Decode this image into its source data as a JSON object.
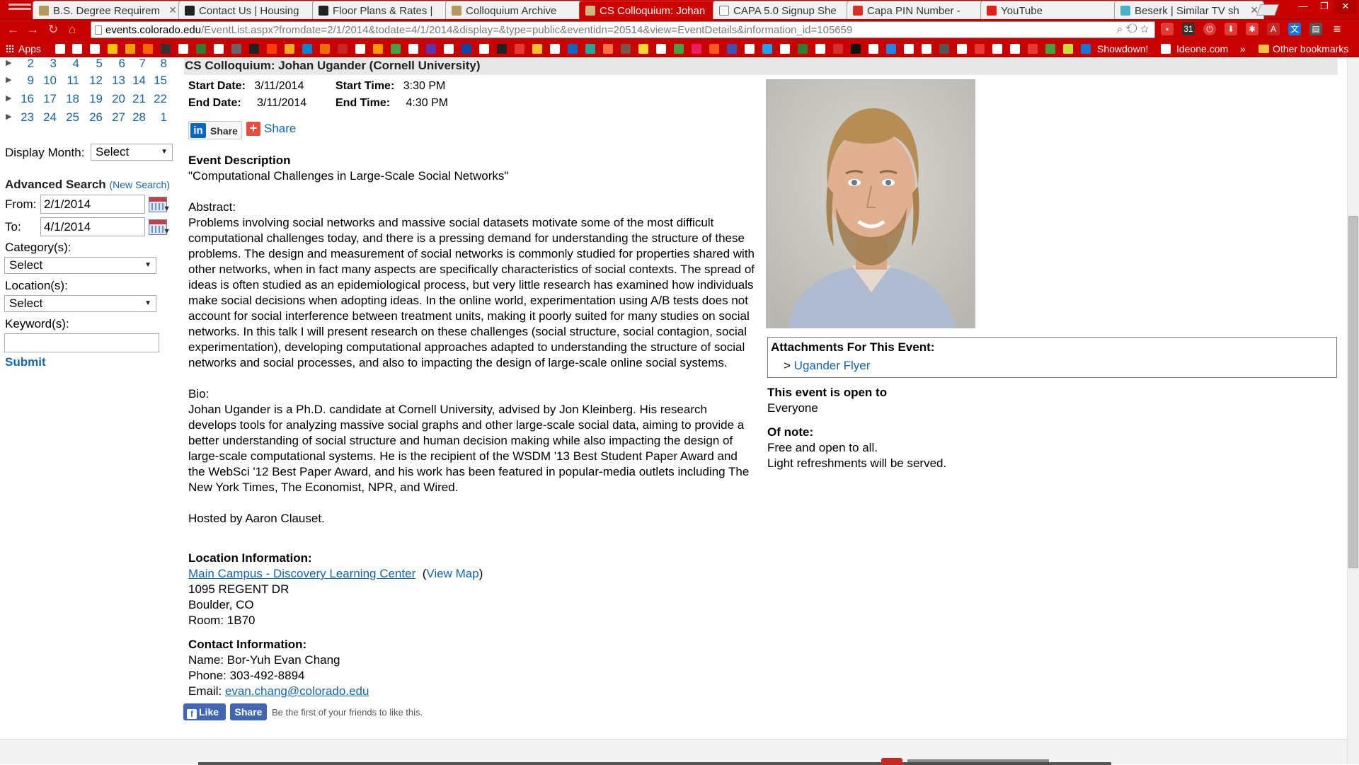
{
  "browser": {
    "tabs": [
      {
        "label": "B.S. Degree Requirem",
        "color": "#b5985a"
      },
      {
        "label": "Contact Us | Housing",
        "color": "#222222"
      },
      {
        "label": "Floor Plans & Rates |",
        "color": "#222222"
      },
      {
        "label": "Colloquium Archive",
        "color": "#b5985a"
      },
      {
        "label": "CS Colloquium: Johan",
        "color": "#cfb87c",
        "active": true
      },
      {
        "label": "CAPA 5.0 Signup She",
        "color": "#ffffff"
      },
      {
        "label": "Capa PIN Number -",
        "color": "#d93025"
      },
      {
        "label": "YouTube",
        "color": "#e62117"
      },
      {
        "label": "Beserk | Similar TV sh",
        "color": "#46b1c9"
      }
    ],
    "url_host": "events.colorado.edu",
    "url_path": "/EventList.aspx?fromdate=2/1/2014&todate=4/1/2014&display=&type=public&eventidn=20514&view=EventDetails&information_id=105659",
    "bookmarks": {
      "apps_label": "Apps",
      "showdown_label": "Showdown!",
      "ideone_label": "Ideone.com",
      "other_label": "Other bookmarks"
    }
  },
  "event": {
    "title": "CS Colloquium: Johan Ugander (Cornell University)",
    "start_date_label": "Start Date:",
    "start_date": "3/11/2014",
    "start_time_label": "Start Time:",
    "start_time": "3:30 PM",
    "end_date_label": "End Date:",
    "end_date": "3/11/2014",
    "end_time_label": "End Time:",
    "end_time": "4:30 PM",
    "linkedin_share": "Share",
    "addthis_share": "Share",
    "description_heading": "Event Description",
    "talk_title": "\"Computational Challenges in Large-Scale Social Networks\"",
    "abstract_heading": "Abstract:",
    "abstract": "Problems involving social networks and massive social datasets motivate some of the most difficult computational challenges today, and there is a pressing demand for understanding the structure of these problems. The design and measurement of social networks is commonly studied for properties shared with other networks, when in fact many aspects are specifically characteristics of social contexts. The spread of ideas is often studied as an epidemiological process, but very little research has examined how individuals make social decisions when adopting ideas. In the online world, experimentation using A/B tests does not account for social interference between treatment units, making it poorly suited for many studies on social networks. In this talk I will present research on these challenges (social structure, social contagion, social experimentation), developing computational approaches adapted to understanding the structure of social networks and social processes, and also to impacting the design of large-scale online social systems.",
    "bio_heading": "Bio:",
    "bio": "Johan Ugander is a Ph.D. candidate at Cornell University, advised by Jon Kleinberg. His research develops tools for analyzing massive social graphs and other large-scale social data, aiming to provide a better understanding of social structure and human decision making while also impacting the design of large-scale computational systems. He is the recipient of the WSDM '13 Best Student Paper Award and the WebSci '12 Best Paper Award, and his work has been featured in popular-media outlets including The New York Times, The Economist, NPR, and Wired.",
    "hosted_by": "Hosted by Aaron Clauset.",
    "location_heading": "Location Information:",
    "location_link": "Main Campus - Discovery Learning Center",
    "view_map_open": "(",
    "view_map": "View Map",
    "view_map_close": ")",
    "address1": "1095 REGENT DR",
    "address2": "Boulder, CO",
    "room": "Room: 1B70",
    "contact_heading": "Contact Information:",
    "contact_name": "Name: Bor-Yuh Evan Chang",
    "contact_phone": "Phone: 303-492-8894",
    "contact_email_label": "Email:",
    "contact_email": "evan.chang@colorado.edu",
    "fb_like": "Like",
    "fb_share": "Share",
    "fb_text": "Be the first of your friends to like this."
  },
  "sidebar": {
    "calendar_rows": [
      [
        "2",
        "3",
        "4",
        "5",
        "6",
        "7",
        "8"
      ],
      [
        "9",
        "10",
        "11",
        "12",
        "13",
        "14",
        "15"
      ],
      [
        "16",
        "17",
        "18",
        "19",
        "20",
        "21",
        "22"
      ],
      [
        "23",
        "24",
        "25",
        "26",
        "27",
        "28",
        "1"
      ]
    ],
    "display_month_label": "Display Month:",
    "display_month_value": "Select",
    "advanced_search": "Advanced Search",
    "new_search": "(New Search)",
    "from_label": "From:",
    "from_value": "2/1/2014",
    "to_label": "To:",
    "to_value": "4/1/2014",
    "category_label": "Category(s):",
    "category_value": "Select",
    "location_label": "Location(s):",
    "location_value": "Select",
    "keyword_label": "Keyword(s):",
    "keyword_value": "",
    "submit": "Submit"
  },
  "right": {
    "attachments_heading": "Attachments For This Event:",
    "attachment_prefix": ">",
    "attachment_link": "Ugander Flyer",
    "open_heading": "This event is open to",
    "open_value": "Everyone",
    "note_heading": "Of note:",
    "note_line1": "Free and open to all.",
    "note_line2": "Light refreshments will be served."
  },
  "colors": {
    "chrome_red": "#c70000",
    "link_blue": "#1565a8",
    "facebook_blue": "#4267b2",
    "linkedin_blue": "#0a66c2"
  }
}
